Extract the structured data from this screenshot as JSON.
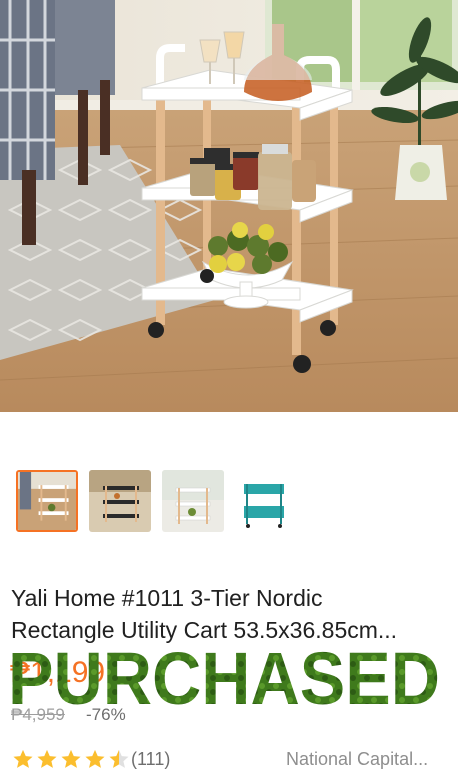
{
  "product": {
    "title_line1": "Yali Home #1011 3-Tier Nordic",
    "title_line2": "Rectangle Utility Cart 53.5x36.85cm...",
    "price": "₱1,199",
    "original_price": "₱4,959",
    "discount": "-76%",
    "rating": 4.5,
    "review_count": "(111)",
    "location": "National Capital..."
  },
  "overlay": {
    "stamp_text": "PURCHASED",
    "stamp_color": "#3f7a1c"
  },
  "gallery": {
    "selected_index": 0,
    "thumbnails": [
      "cart-white-room",
      "cart-black-kitchen",
      "cart-white-kitchen",
      "cart-teal"
    ]
  },
  "colors": {
    "accent": "#f57224",
    "star": "#fbbe2e"
  }
}
